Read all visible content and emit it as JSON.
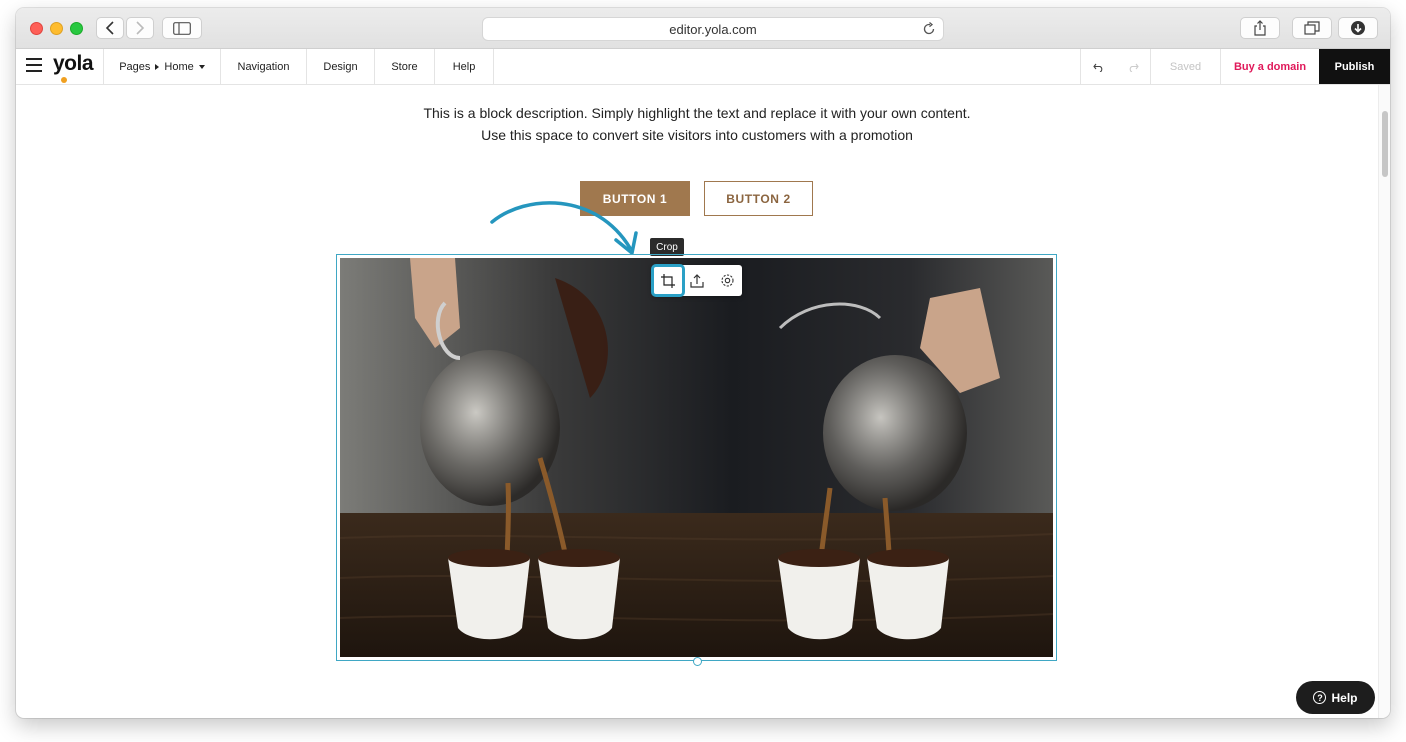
{
  "browser": {
    "url": "editor.yola.com"
  },
  "appbar": {
    "logo": "yola",
    "pages_label": "Pages",
    "current_page": "Home",
    "nav_items": [
      "Navigation",
      "Design",
      "Store",
      "Help"
    ],
    "saved_label": "Saved",
    "buy_domain_label": "Buy a domain",
    "publish_label": "Publish"
  },
  "content": {
    "description_line1": "This is a block description. Simply highlight the text and replace it with your own content.",
    "description_line2": "Use this space to convert site visitors into customers with a promotion",
    "button1_label": "BUTTON 1",
    "button2_label": "BUTTON 2",
    "tooltip": "Crop",
    "image_toolbar": [
      "crop-icon",
      "upload-icon",
      "settings-icon"
    ]
  },
  "help_button": {
    "label": "Help",
    "icon": "?"
  },
  "colors": {
    "accent_brown": "#a0784e",
    "selection_blue": "#3fa7c4",
    "buy_domain_pink": "#e0195a"
  }
}
